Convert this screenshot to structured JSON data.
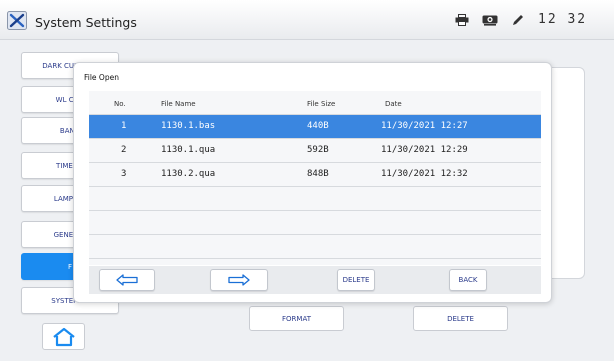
{
  "window": {
    "title": "System Settings",
    "clock": "12 32"
  },
  "toolbar_icons": [
    "printer-icon",
    "camera-icon",
    "pen-icon"
  ],
  "sidebar": {
    "items": [
      {
        "label": "DARK CURRENT",
        "active": false
      },
      {
        "label": "WL CALI",
        "active": false
      },
      {
        "label": "BAND",
        "active": false
      },
      {
        "label": "TIME SE",
        "active": false
      },
      {
        "label": "LAMP MA",
        "active": false
      },
      {
        "label": "GENERAL",
        "active": false
      },
      {
        "label": "F",
        "active": true
      },
      {
        "label": "SYSTEM IN",
        "active": false
      }
    ]
  },
  "background_buttons": {
    "format": "FORMAT",
    "delete": "DELETE"
  },
  "dialog": {
    "title": "File Open",
    "columns": [
      "No.",
      "File Name",
      "File Size",
      "Date"
    ],
    "rows": [
      {
        "no": "1",
        "name": "1130.1.bas",
        "size": "440B",
        "date": "11/30/2021 12:27",
        "selected": true
      },
      {
        "no": "2",
        "name": "1130.1.qua",
        "size": "592B",
        "date": "11/30/2021 12:29",
        "selected": false
      },
      {
        "no": "3",
        "name": "1130.2.qua",
        "size": "848B",
        "date": "11/30/2021 12:32",
        "selected": false
      }
    ],
    "buttons": {
      "delete": "DELETE",
      "back": "BACK"
    }
  },
  "colors": {
    "accent": "#1a8bf0",
    "selected_row": "#3a86e0",
    "button_text": "#2a3a8a"
  }
}
